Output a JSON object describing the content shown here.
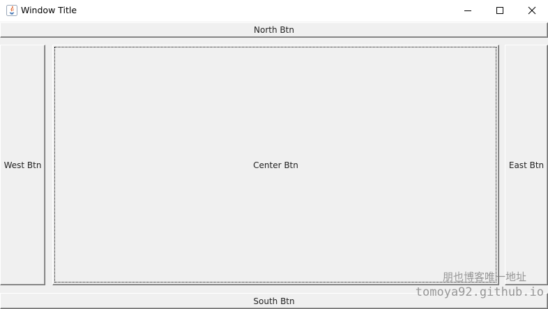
{
  "window": {
    "title": "Window Title",
    "controls": {
      "minimize_icon": "minimize-icon",
      "maximize_icon": "maximize-icon",
      "close_icon": "close-icon"
    }
  },
  "buttons": {
    "north": "North Btn",
    "south": "South Btn",
    "west": "West Btn",
    "east": "East Btn",
    "center": "Center Btn"
  },
  "watermark": {
    "line1": "朋也博客唯一地址",
    "line2": "tomoya92.github.io"
  },
  "colors": {
    "background": "#f0f0f0",
    "titlebar": "#ffffff",
    "button_shadow": "#6d6d6d"
  }
}
